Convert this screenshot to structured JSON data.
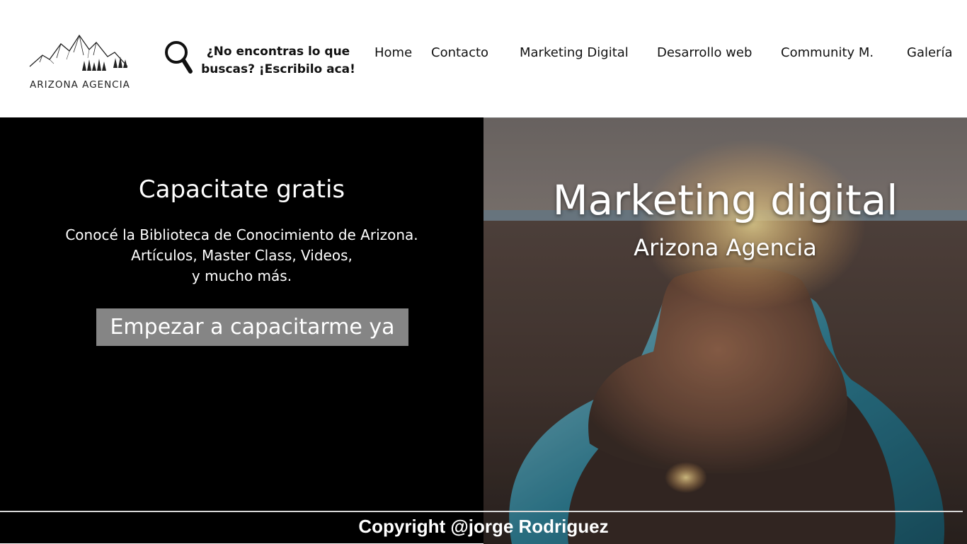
{
  "header": {
    "logo_text": "ARIZONA AGENCIA",
    "search_prompt": {
      "line1": "¿No encontras lo que",
      "line2": "buscas? ¡Escribilo aca!"
    },
    "nav": [
      {
        "label": "Home"
      },
      {
        "label": "Contacto"
      },
      {
        "label": "Marketing Digital"
      },
      {
        "label": "Desarrollo web"
      },
      {
        "label": "Community M."
      },
      {
        "label": "Galería"
      }
    ]
  },
  "left": {
    "title": "Capacitate gratis",
    "description": [
      "Conocé la Biblioteca de Conocimiento de Arizona.",
      "Artículos, Master Class, Videos,",
      "y mucho más."
    ],
    "cta_label": "Empezar a capacitarme ya"
  },
  "hero": {
    "title": "Marketing digital",
    "subtitle": "Arizona Agencia"
  },
  "footer": {
    "copyright": "Copyright @jorge Rodriguez"
  },
  "colors": {
    "left_bg": "#000000",
    "cta_bg": "#858585",
    "header_bg": "#ffffff"
  }
}
